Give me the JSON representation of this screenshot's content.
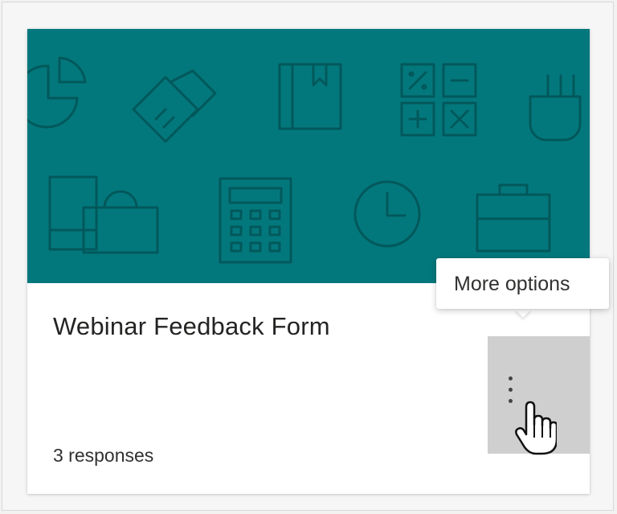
{
  "card": {
    "title": "Webinar Feedback Form",
    "responses": "3 responses",
    "banner_color": "#03787c",
    "banner_icons": [
      "pie-chart-icon",
      "handshake-icon",
      "book-icon",
      "calculator-icon",
      "plug-icon",
      "devices-icon",
      "shopping-bag-icon",
      "clock-icon",
      "briefcase-icon"
    ]
  },
  "more_options": {
    "tooltip": "More options",
    "button_icon": "more-vertical-icon",
    "button_color": "#cfcfcf"
  },
  "cursor": {
    "icon": "hand-pointer-icon"
  }
}
